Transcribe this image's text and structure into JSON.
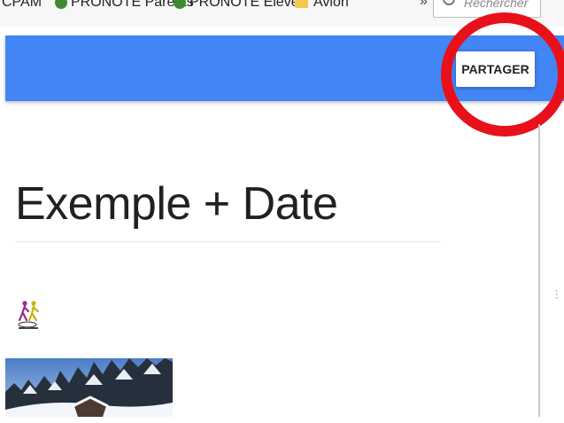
{
  "bookmarks_bar": {
    "items": [
      {
        "label": "CPAM"
      },
      {
        "label": "PRONOTE Parents"
      },
      {
        "label": "PRONOTE Elèves"
      },
      {
        "label": "Avion"
      }
    ],
    "overflow_label": "»",
    "search_placeholder": "Rechercher"
  },
  "app_bar": {
    "color": "#4285f4",
    "share_label": "PARTAGER"
  },
  "annotation": {
    "circle_color": "#e8101a"
  },
  "page": {
    "title": "Exemple + Date"
  }
}
